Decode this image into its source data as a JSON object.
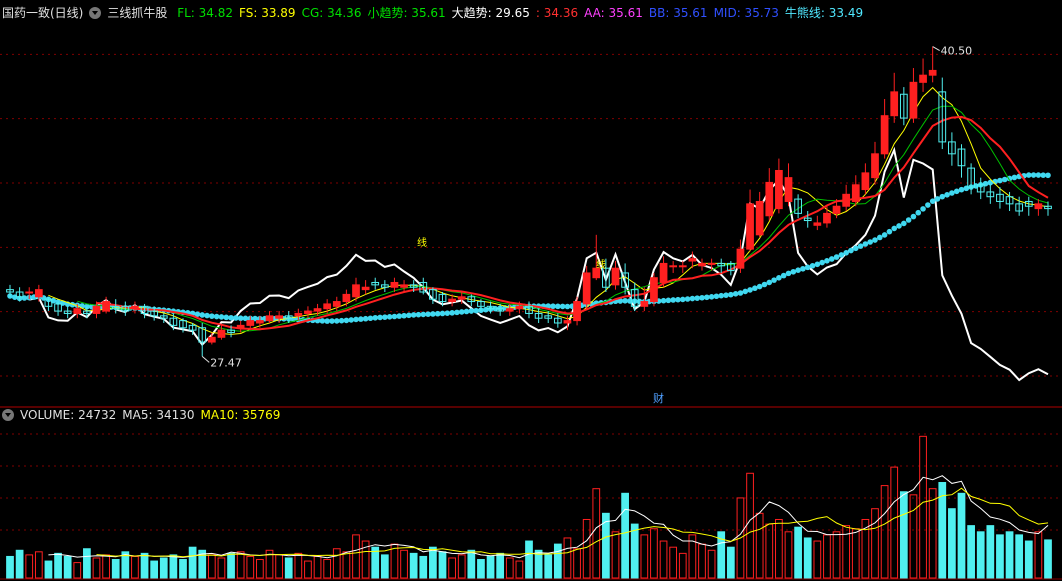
{
  "header": {
    "stock": "国药一致(日线)",
    "indicator": "三线抓牛股",
    "items": [
      {
        "text": "FL: 34.82",
        "color": "#00e000"
      },
      {
        "text": "FS: 33.89",
        "color": "#ffff00"
      },
      {
        "text": "CG: 34.36",
        "color": "#00e000"
      },
      {
        "text": "小趋势: 35.61",
        "color": "#00e000"
      },
      {
        "text": "大趋势: 29.65",
        "color": "#ffffff"
      },
      {
        "text": ": 34.36",
        "color": "#ff3030"
      },
      {
        "text": "AA: 35.61",
        "color": "#ff40ff"
      },
      {
        "text": "BB: 35.61",
        "color": "#3050ff"
      },
      {
        "text": "MID: 35.73",
        "color": "#3050ff"
      },
      {
        "text": "牛熊线: 33.49",
        "color": "#50e8ff"
      }
    ]
  },
  "volume_header": {
    "items": [
      {
        "text": "VOLUME: 24732",
        "color": "#e0e0e0"
      },
      {
        "text": "MA5: 34130",
        "color": "#e0e0e0"
      },
      {
        "text": "MA10: 35769",
        "color": "#ffff00"
      }
    ]
  },
  "labels": {
    "high": "40.50",
    "low": "27.47",
    "fin": "财",
    "line_tag": "线"
  },
  "colors": {
    "up": "#ff2020",
    "down": "#50f0f0",
    "bull_bear": "#40d8f0",
    "trend": "#ffffff",
    "fs": "#ffff00",
    "fl": "#00c000",
    "ma": "#ff2020",
    "grid": "#800000"
  },
  "chart_data": [
    {
      "type": "candlestick",
      "open": [
        30.3,
        30.2,
        30.2,
        30.0,
        29.9,
        29.7,
        29.4,
        29.3,
        29.4,
        29.3,
        29.4,
        29.6,
        29.6,
        29.5,
        29.6,
        29.4,
        29.2,
        29.1,
        29.0,
        28.8,
        28.7,
        28.1,
        28.3,
        28.6,
        28.7,
        28.8,
        28.9,
        29.0,
        29.1,
        29.2,
        29.2,
        29.3,
        29.4,
        29.5,
        29.6,
        29.8,
        30.0,
        30.3,
        30.6,
        30.5,
        30.4,
        30.4,
        30.5,
        30.6,
        30.3,
        30.1,
        29.8,
        29.9,
        30.0,
        29.8,
        29.6,
        29.5,
        29.4,
        29.5,
        29.6,
        29.3,
        29.2,
        29.1,
        28.9,
        29.0,
        29.7,
        30.8,
        31.2,
        30.5,
        31.0,
        30.3,
        29.6,
        29.8,
        30.6,
        31.3,
        31.3,
        31.5,
        31.3,
        31.4,
        31.4,
        31.4,
        31.2,
        32.0,
        32.6,
        33.4,
        33.7,
        34.0,
        34.1,
        33.3,
        33.0,
        33.1,
        33.5,
        33.8,
        34.0,
        34.5,
        35.0,
        36.0,
        37.6,
        38.5,
        37.5,
        39.0,
        39.3,
        38.6,
        36.5,
        36.2,
        35.4,
        34.7,
        34.4,
        34.3,
        34.2,
        33.9,
        34.0,
        33.7,
        33.8
      ],
      "close": [
        30.2,
        30.0,
        30.2,
        30.3,
        29.6,
        29.4,
        29.3,
        29.5,
        29.3,
        29.6,
        29.8,
        29.5,
        29.4,
        29.6,
        29.3,
        29.2,
        29.1,
        28.8,
        28.7,
        28.6,
        28.1,
        28.3,
        28.6,
        28.5,
        28.8,
        29.0,
        29.0,
        29.2,
        29.2,
        29.1,
        29.3,
        29.4,
        29.5,
        29.7,
        29.8,
        30.1,
        30.5,
        30.4,
        30.5,
        30.4,
        30.6,
        30.5,
        30.4,
        30.2,
        29.9,
        29.8,
        29.9,
        30.0,
        29.8,
        29.6,
        29.5,
        29.4,
        29.5,
        29.6,
        29.3,
        29.1,
        29.1,
        28.9,
        29.0,
        29.8,
        31.0,
        31.2,
        30.4,
        31.2,
        30.4,
        29.6,
        29.8,
        30.8,
        31.4,
        31.3,
        31.3,
        31.6,
        31.4,
        31.4,
        31.3,
        31.1,
        32.0,
        33.9,
        34.0,
        34.8,
        35.3,
        35.0,
        33.5,
        33.2,
        33.1,
        33.5,
        33.8,
        34.3,
        34.7,
        35.2,
        36.0,
        37.6,
        38.6,
        37.5,
        39.0,
        39.3,
        39.5,
        36.5,
        36.0,
        35.5,
        34.6,
        34.4,
        34.2,
        34.0,
        33.9,
        33.6,
        33.8,
        33.9,
        33.7
      ],
      "high": [
        30.5,
        30.4,
        30.4,
        30.5,
        30.0,
        29.8,
        29.6,
        29.7,
        29.6,
        29.8,
        30.0,
        29.9,
        29.8,
        29.8,
        29.7,
        29.6,
        29.3,
        29.3,
        29.1,
        28.9,
        28.9,
        28.5,
        28.8,
        28.8,
        29.0,
        29.2,
        29.2,
        29.4,
        29.4,
        29.4,
        29.5,
        29.6,
        29.7,
        29.9,
        30.0,
        30.3,
        30.8,
        30.7,
        30.8,
        30.7,
        30.8,
        30.7,
        30.7,
        30.8,
        30.4,
        30.2,
        30.1,
        30.2,
        30.1,
        29.9,
        29.8,
        29.7,
        29.7,
        29.8,
        29.8,
        29.5,
        29.4,
        29.3,
        29.2,
        30.0,
        31.3,
        32.6,
        31.6,
        31.5,
        31.4,
        30.6,
        30.4,
        31.0,
        31.7,
        31.5,
        31.5,
        31.9,
        31.6,
        31.6,
        31.6,
        31.5,
        32.4,
        34.5,
        34.4,
        35.4,
        35.8,
        35.6,
        34.3,
        33.6,
        33.4,
        33.8,
        34.1,
        34.7,
        35.1,
        35.6,
        36.5,
        38.3,
        39.4,
        38.8,
        39.6,
        40.0,
        40.5,
        39.2,
        36.9,
        36.4,
        35.6,
        35.0,
        34.7,
        34.6,
        34.4,
        34.2,
        34.2,
        34.1,
        34.0
      ],
      "low": [
        30.0,
        29.8,
        29.9,
        29.8,
        29.4,
        29.2,
        29.1,
        29.1,
        29.1,
        29.1,
        29.3,
        29.3,
        29.2,
        29.3,
        29.1,
        29.0,
        28.9,
        28.6,
        28.5,
        28.4,
        27.5,
        28.0,
        28.2,
        28.3,
        28.5,
        28.6,
        28.7,
        28.9,
        28.9,
        28.9,
        29.0,
        29.1,
        29.2,
        29.3,
        29.4,
        29.6,
        29.8,
        30.1,
        30.3,
        30.2,
        30.2,
        30.2,
        30.2,
        30.1,
        29.7,
        29.6,
        29.6,
        29.7,
        29.6,
        29.4,
        29.3,
        29.2,
        29.2,
        29.3,
        29.1,
        28.9,
        28.9,
        28.7,
        28.6,
        28.8,
        29.5,
        30.7,
        30.2,
        30.3,
        30.1,
        29.4,
        29.4,
        29.6,
        30.4,
        31.0,
        31.0,
        31.2,
        31.1,
        31.1,
        31.0,
        30.9,
        31.0,
        31.9,
        32.5,
        33.2,
        33.5,
        33.8,
        33.3,
        32.9,
        32.8,
        32.9,
        33.3,
        33.6,
        33.8,
        34.3,
        34.7,
        35.8,
        37.3,
        37.2,
        37.3,
        38.6,
        39.0,
        36.2,
        35.5,
        35.0,
        34.3,
        34.1,
        33.9,
        33.7,
        33.6,
        33.4,
        33.4,
        33.4,
        33.4
      ],
      "ylim": [
        25.5,
        41.7
      ],
      "xlabel": "",
      "ylabel": ""
    },
    {
      "type": "bar",
      "name": "VOLUME",
      "values": [
        14000,
        18000,
        15000,
        17000,
        11000,
        16000,
        14000,
        10000,
        19000,
        13000,
        15000,
        12000,
        17000,
        14000,
        16000,
        11000,
        13000,
        15000,
        12000,
        20000,
        18000,
        15000,
        13000,
        16000,
        17000,
        14000,
        12000,
        18000,
        15000,
        13000,
        16000,
        11000,
        14000,
        12000,
        19000,
        17000,
        28000,
        24000,
        20000,
        15000,
        22000,
        18000,
        16000,
        14000,
        20000,
        17000,
        13000,
        15000,
        18000,
        12000,
        14000,
        16000,
        13000,
        11000,
        24000,
        18000,
        15000,
        22000,
        26000,
        19000,
        38000,
        58000,
        42000,
        30000,
        55000,
        35000,
        28000,
        32000,
        24000,
        20000,
        16000,
        28000,
        22000,
        18000,
        30000,
        20000,
        52000,
        68000,
        42000,
        35000,
        38000,
        30000,
        33000,
        26000,
        24000,
        28000,
        30000,
        34000,
        32000,
        38000,
        45000,
        60000,
        72000,
        56000,
        54000,
        92000,
        58000,
        62000,
        45000,
        55000,
        34000,
        30000,
        34000,
        28000,
        30000,
        28000,
        24000,
        30000,
        24732
      ],
      "ma5": [
        null,
        null,
        null,
        null,
        15000,
        15400,
        14600,
        13600,
        14000,
        14400,
        14200,
        13800,
        15200,
        14200,
        14800,
        14000,
        14200,
        13800,
        13400,
        14200,
        15600,
        16000,
        14800,
        16800,
        16000,
        15000,
        14600,
        15400,
        15200,
        14400,
        14800,
        14600,
        14000,
        13200,
        14400,
        16600,
        18000,
        20000,
        21600,
        20800,
        21800,
        21200,
        20200,
        17000,
        18000,
        17000,
        16000,
        15800,
        16600,
        15000,
        14400,
        15000,
        14600,
        13200,
        15600,
        16400,
        16200,
        17200,
        19200,
        20000,
        24200,
        32600,
        36600,
        37400,
        44600,
        43600,
        40200,
        35600,
        34800,
        27800,
        24000,
        24000,
        22000,
        20800,
        22800,
        23600,
        28400,
        37600,
        42400,
        49400,
        47000,
        42600,
        35600,
        30400,
        30200,
        28200,
        28200,
        28400,
        29600,
        32400,
        35800,
        41800,
        49400,
        54200,
        57400,
        65400,
        63800,
        66400,
        61400,
        62800,
        50000,
        45200,
        39600,
        38200,
        36000,
        31200,
        29600,
        28800,
        34130
      ],
      "ma10": [
        null,
        null,
        null,
        null,
        null,
        null,
        null,
        null,
        null,
        15200,
        14800,
        14200,
        14600,
        14300,
        14600,
        14100,
        14200,
        14500,
        13800,
        14500,
        14800,
        14900,
        14300,
        15500,
        15400,
        14800,
        14700,
        15100,
        15200,
        15300,
        15400,
        14800,
        14600,
        14800,
        14700,
        15800,
        16300,
        17200,
        17300,
        17600,
        19200,
        19600,
        19800,
        18600,
        18400,
        19000,
        18000,
        17000,
        16800,
        17000,
        15800,
        15700,
        15400,
        15400,
        16100,
        15400,
        15600,
        15900,
        16400,
        18600,
        19900,
        23600,
        26600,
        28200,
        29300,
        31000,
        32400,
        33400,
        32800,
        31800,
        29800,
        29600,
        28600,
        27400,
        25300,
        23800,
        26000,
        29800,
        31600,
        35100,
        35500,
        35500,
        36400,
        36900,
        38700,
        39900,
        35700,
        33000,
        31800,
        31400,
        32300,
        35000,
        38900,
        41300,
        43800,
        49200,
        50600,
        53400,
        54100,
        58300,
        53000,
        51000,
        48500,
        48400,
        46700,
        40500,
        37700,
        35000,
        35769
      ],
      "ylim": [
        0,
        100000
      ]
    }
  ]
}
